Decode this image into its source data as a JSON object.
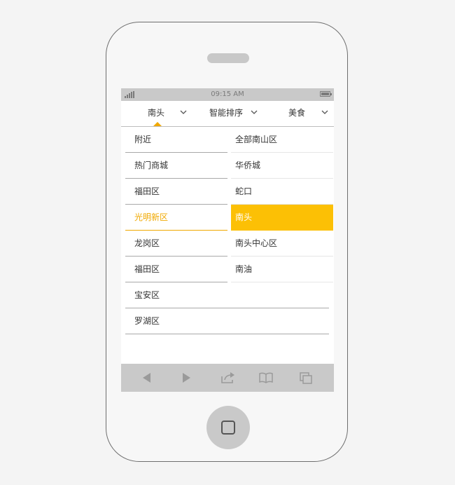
{
  "status_bar": {
    "time": "09:15 AM"
  },
  "filter_tabs": [
    {
      "label": "南头",
      "selected": true
    },
    {
      "label": "智能排序",
      "selected": false
    },
    {
      "label": "美食",
      "selected": false
    }
  ],
  "districts": [
    {
      "label": "附近",
      "selected": false
    },
    {
      "label": "热门商城",
      "selected": false
    },
    {
      "label": "福田区",
      "selected": false
    },
    {
      "label": "光明新区",
      "selected": true
    },
    {
      "label": "龙岗区",
      "selected": false
    },
    {
      "label": "福田区",
      "selected": false
    },
    {
      "label": "宝安区",
      "selected": false
    },
    {
      "label": "罗湖区",
      "selected": false
    }
  ],
  "subareas": [
    {
      "label": "全部南山区",
      "selected": false
    },
    {
      "label": "华侨城",
      "selected": false
    },
    {
      "label": "蛇口",
      "selected": false
    },
    {
      "label": "南头",
      "selected": true
    },
    {
      "label": "南头中心区",
      "selected": false
    },
    {
      "label": "南油",
      "selected": false
    }
  ],
  "toolbar_icons": [
    "back-icon",
    "forward-icon",
    "share-icon",
    "bookmarks-icon",
    "tabs-icon"
  ],
  "colors": {
    "accent": "#f0a800",
    "selected_bg": "#fcc005",
    "chrome": "#c9c9c9",
    "text": "#333333"
  }
}
